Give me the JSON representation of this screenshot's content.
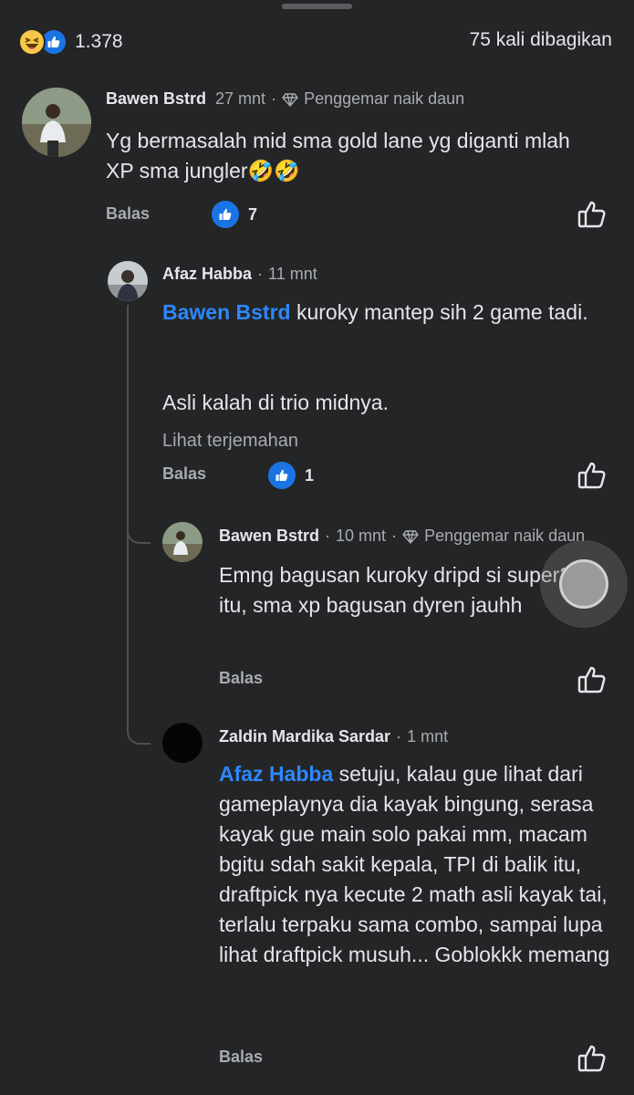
{
  "summary": {
    "reactions": [
      "haha",
      "like"
    ],
    "count": "1.378",
    "shares": "75 kali dibagikan"
  },
  "comments": [
    {
      "name": "Bawen Bstrd",
      "time": "27 mnt",
      "badge": "Penggemar naik daun",
      "text": "Yg bermasalah mid sma gold lane yg diganti mlah XP sma jungler🤣🤣",
      "reply_label": "Balas",
      "likes": "7"
    },
    {
      "name": "Afaz Habba",
      "time": "11 mnt",
      "mention": "Bawen Bstrd",
      "text_line1": " kuroky mantep sih 2 game tadi.",
      "text_line2": "Asli kalah di trio midnya.",
      "translate": "Lihat terjemahan",
      "reply_label": "Balas",
      "likes": "1"
    },
    {
      "name": "Bawen Bstrd",
      "time": "10 mnt",
      "badge": "Penggemar naik daun",
      "text": "Emng bagusan kuroky dripd si super2 itu, sma xp bagusan dyren jauhh",
      "reply_label": "Balas"
    },
    {
      "name": "Zaldin Mardika Sardar",
      "time": "1 mnt",
      "mention": "Afaz Habba",
      "text": " setuju, kalau gue lihat dari gameplaynya dia kayak bingung, serasa kayak gue main solo pakai mm, macam bgitu sdah sakit kepala, TPI di balik itu, draftpick nya kecute 2 math asli kayak tai, terlalu terpaku sama combo, sampai lupa lihat draftpick musuh... Goblokkk memang",
      "reply_label": "Balas"
    }
  ],
  "colors": {
    "background": "#242526",
    "mention": "#2d88ff",
    "like": "#1b74e4"
  }
}
